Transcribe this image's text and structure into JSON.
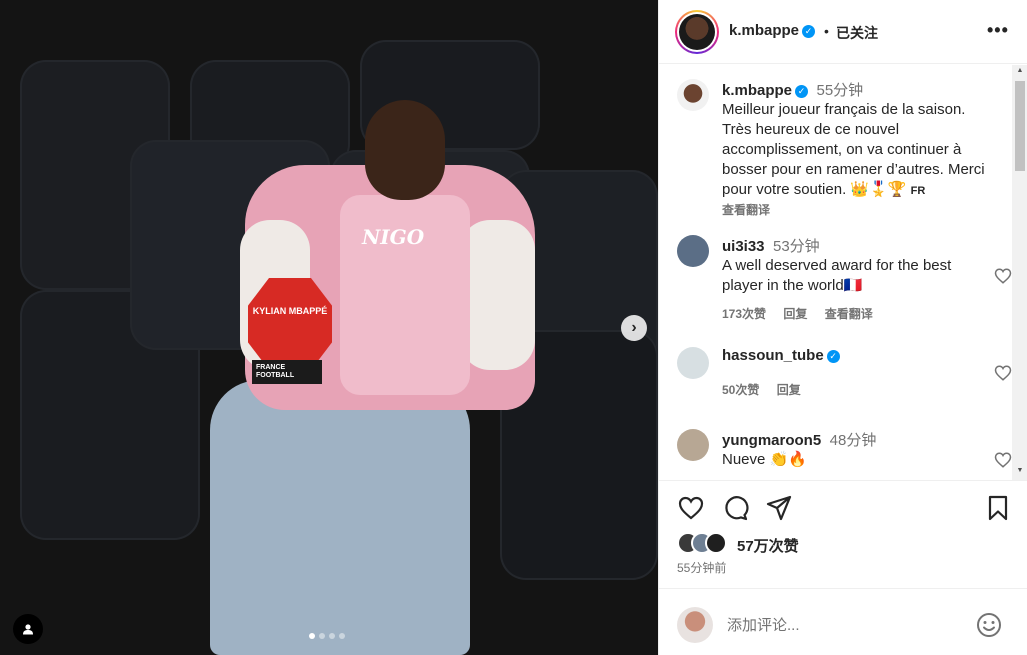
{
  "photo": {
    "trophy_name": "KYLIAN MBAPPÉ",
    "trophy_base": "FRANCE FOOTBALL",
    "jacket_logo": "NIGO",
    "slide_count": 4,
    "active_slide": 0
  },
  "header": {
    "username": "k.mbappe",
    "separator": "•",
    "follow_status": "已关注"
  },
  "caption": {
    "username": "k.mbappe",
    "time": "55分钟",
    "text": "Meilleur joueur français de la saison. Très heureux de ce nouvel accomplissement, on va continuer à bosser pour en ramener d’autres. Merci pour votre soutien. 👑🎖️🏆",
    "flag": "FR",
    "translate": "查看翻译"
  },
  "comments": [
    {
      "username": "ui3i33",
      "verified": false,
      "time": "53分钟",
      "text": "A well deserved award for the best player in the world🇫🇷",
      "likes": "173次赞",
      "reply": "回复",
      "translate": "查看翻译"
    },
    {
      "username": "hassoun_tube",
      "verified": true,
      "time": "",
      "text": "",
      "likes": "50次赞",
      "reply": "回复",
      "translate": ""
    },
    {
      "username": "yungmaroon5",
      "verified": false,
      "time": "48分钟",
      "text": "Nueve 👏🔥",
      "likes": "",
      "reply": "",
      "translate": ""
    }
  ],
  "stats": {
    "likes": "57万次赞",
    "posted": "55分钟前"
  },
  "add_comment": {
    "placeholder": "添加评论..."
  },
  "colors": {
    "verified": "#0095f6",
    "text": "#262626",
    "muted": "#737373",
    "divider": "#efefef"
  }
}
